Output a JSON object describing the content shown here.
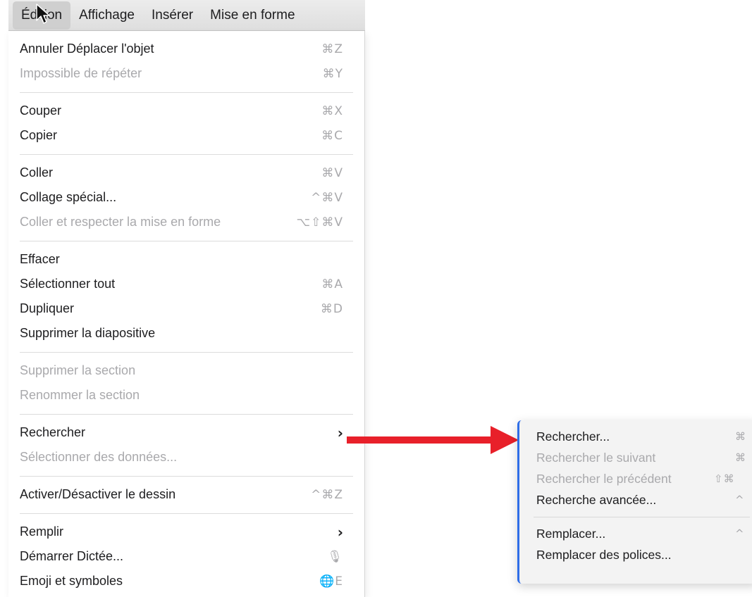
{
  "menubar": {
    "items": [
      "Édition",
      "Affichage",
      "Insérer",
      "Mise en forme"
    ]
  },
  "menu": {
    "items": [
      {
        "label": "Annuler Déplacer l'objet",
        "shortcut": "⌘Z",
        "disabled": false
      },
      {
        "label": "Impossible de répéter",
        "shortcut": "⌘Y",
        "disabled": true
      },
      {
        "label": "Couper",
        "shortcut": "⌘X",
        "disabled": false
      },
      {
        "label": "Copier",
        "shortcut": "⌘C",
        "disabled": false
      },
      {
        "label": "Coller",
        "shortcut": "⌘V",
        "disabled": false
      },
      {
        "label": "Collage spécial...",
        "shortcut": "^⌘V",
        "disabled": false
      },
      {
        "label": "Coller et respecter la mise en forme",
        "shortcut": "⌥⇧⌘V",
        "disabled": true
      },
      {
        "label": "Effacer",
        "shortcut": "",
        "disabled": false
      },
      {
        "label": "Sélectionner tout",
        "shortcut": "⌘A",
        "disabled": false
      },
      {
        "label": "Dupliquer",
        "shortcut": "⌘D",
        "disabled": false
      },
      {
        "label": "Supprimer la diapositive",
        "shortcut": "",
        "disabled": false
      },
      {
        "label": "Supprimer la section",
        "shortcut": "",
        "disabled": true
      },
      {
        "label": "Renommer la section",
        "shortcut": "",
        "disabled": true
      },
      {
        "label": "Rechercher",
        "shortcut": "›",
        "disabled": false
      },
      {
        "label": "Sélectionner des données...",
        "shortcut": "",
        "disabled": true
      },
      {
        "label": "Activer/Désactiver le dessin",
        "shortcut": "^⌘Z",
        "disabled": false
      },
      {
        "label": "Remplir",
        "shortcut": "›",
        "disabled": false
      },
      {
        "label": "Démarrer Dictée...",
        "shortcut": "🎙",
        "disabled": false
      },
      {
        "label": "Emoji et symboles",
        "shortcut": "🌐E",
        "disabled": false
      }
    ]
  },
  "submenu": {
    "items": [
      {
        "label": "Rechercher...",
        "shortcut": "⌘",
        "disabled": false
      },
      {
        "label": "Rechercher le suivant",
        "shortcut": "⌘",
        "disabled": true
      },
      {
        "label": "Rechercher le précédent",
        "shortcut": "⇧⌘",
        "disabled": true
      },
      {
        "label": "Recherche avancée...",
        "shortcut": "^",
        "disabled": false
      },
      {
        "label": "Remplacer...",
        "shortcut": "^",
        "disabled": false
      },
      {
        "label": "Remplacer des polices...",
        "shortcut": "",
        "disabled": false
      }
    ]
  },
  "colors": {
    "arrow": "#e8202a",
    "submenu_accent": "#2f6ee8",
    "disabled_text": "#a9a9ac"
  }
}
